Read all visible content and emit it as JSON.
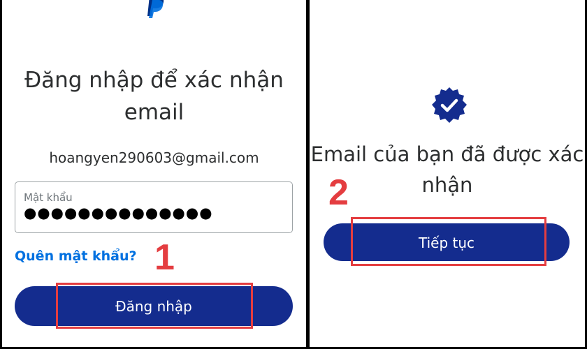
{
  "colors": {
    "brand_blue": "#142c8e",
    "link_blue": "#0070e0",
    "annotation_red": "#e43d40",
    "text_dark": "#2c2e2f"
  },
  "login_screen": {
    "logo_icon": "paypal-logo-icon",
    "heading": "Đăng nhập để xác nhận email",
    "email": "hoangyen290603@gmail.com",
    "password_label": "Mật khẩu",
    "password_value": "●●●●●●●●●●●●●●",
    "forgot_password": "Quên mật khẩu?",
    "step_number": "1",
    "login_button": "Đăng nhập"
  },
  "confirmed_screen": {
    "badge_icon": "verified-check-badge-icon",
    "heading": "Email của bạn đã được xác nhận",
    "step_number": "2",
    "continue_button": "Tiếp tục"
  }
}
